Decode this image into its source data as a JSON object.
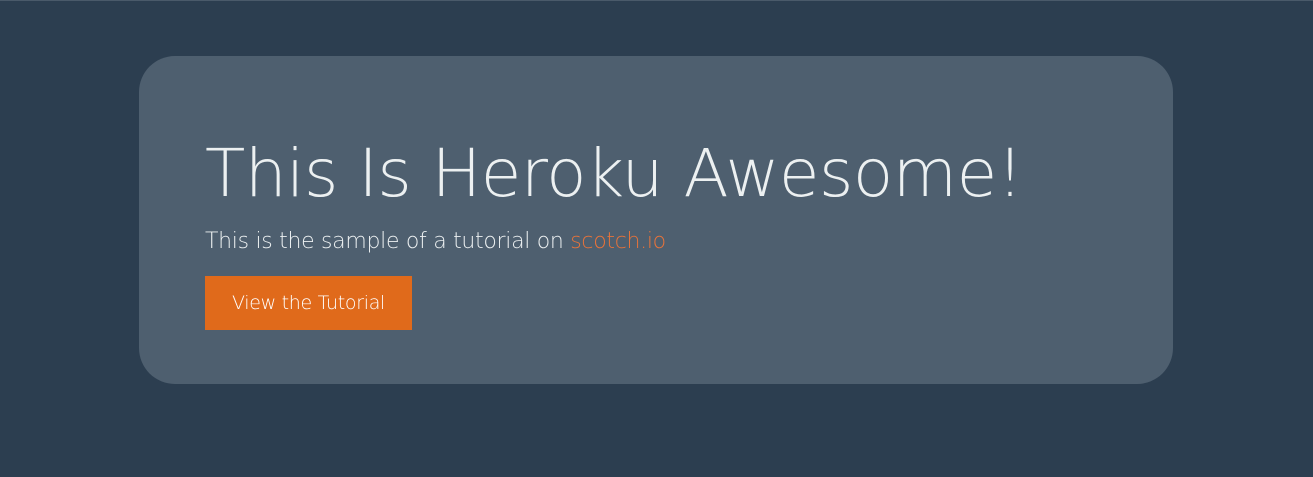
{
  "hero": {
    "title": "This Is Heroku Awesome!",
    "lead_text": "This is the sample of a tutorial on ",
    "lead_link": "scotch.io",
    "button_label": "View the Tutorial"
  },
  "colors": {
    "background": "#2c3e50",
    "panel": "#4e5f6f",
    "text": "#ecf0f1",
    "link": "#e8733a",
    "button": "#e06a1b"
  }
}
